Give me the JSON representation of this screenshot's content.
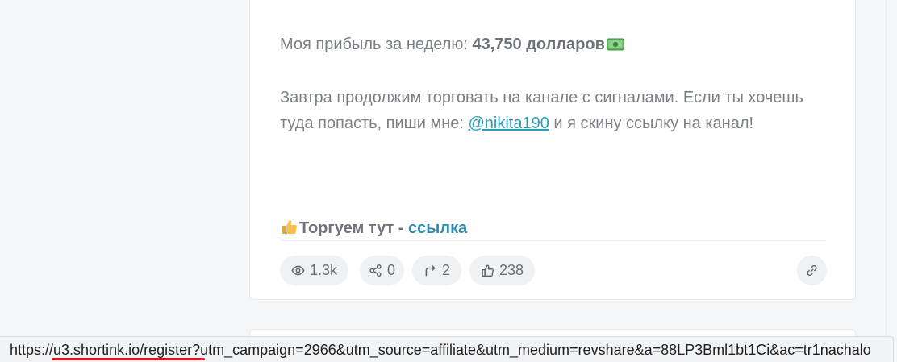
{
  "post": {
    "profit_prefix": "Моя прибыль за неделю: ",
    "profit_value": "43,750 долларов",
    "plan_text_1": "Завтра продолжим торговать на канале с сигналами. Если ты хочешь туда попасть, пиши мне: ",
    "mention": "@nikita190",
    "plan_text_2": " и я скину ссылку на канал!",
    "trade_prefix": "Торгуем тут - ",
    "trade_link": "ссылка"
  },
  "stats": {
    "views": "1.3k",
    "shares": "0",
    "reposts": "2",
    "likes": "238"
  },
  "status_bar": {
    "url": "https://u3.shortink.io/register?utm_campaign=2966&utm_source=affiliate&utm_medium=revshare&a=88LP3Bml1bt1Ci&ac=tr1nachalo"
  },
  "colors": {
    "accent_link": "#2a9cb8",
    "underline_highlight": "#e0171b"
  },
  "icons": [
    "money-icon",
    "thumbs-up-icon",
    "eye-icon",
    "share-icon",
    "repost-icon",
    "like-icon",
    "link-icon"
  ]
}
